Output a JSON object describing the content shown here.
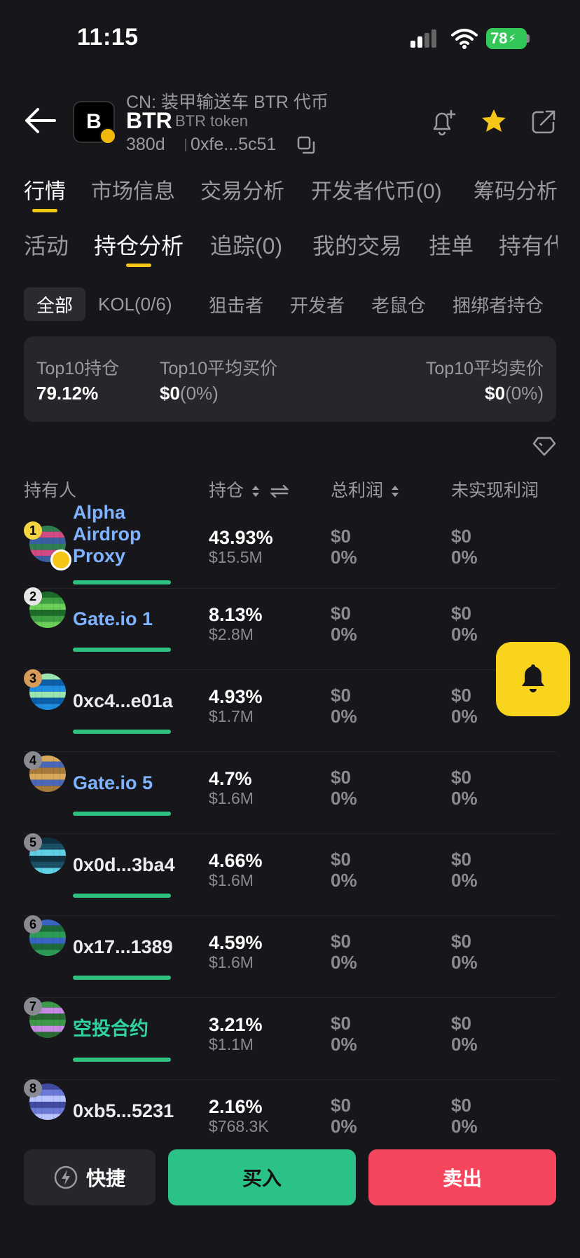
{
  "status_bar": {
    "time": "11:15",
    "battery": "78"
  },
  "token": {
    "logo_letter": "B",
    "cn_name": "CN: 装甲输送车 BTR 代币",
    "symbol": "BTR",
    "name": "BTR token",
    "age": "380d",
    "address": "0xfe...5c51"
  },
  "tabs_primary": [
    "行情",
    "市场信息",
    "交易分析",
    "开发者代币(0)",
    "筹码分析"
  ],
  "tabs_secondary": [
    "活动",
    "持仓分析",
    "追踪(0)",
    "我的交易",
    "挂单",
    "持有代"
  ],
  "filters": [
    "全部",
    "KOL(0/6)",
    "狙击者",
    "开发者",
    "老鼠仓",
    "捆绑者持仓"
  ],
  "summary": {
    "top10_hold_label": "Top10持仓",
    "top10_hold_value": "79.12%",
    "avg_buy_label": "Top10平均买价",
    "avg_buy_value": "$0",
    "avg_buy_change": "(0%)",
    "avg_sell_label": "Top10平均卖价",
    "avg_sell_value": "$0",
    "avg_sell_change": "(0%)"
  },
  "columns": {
    "holder": "持有人",
    "position": "持仓",
    "total_pnl": "总利润",
    "unrealized_pnl": "未实现利润"
  },
  "holders": [
    {
      "rank": "1",
      "name": "Alpha Airdrop Proxy",
      "name_lines": [
        "Alpha",
        "Airdrop",
        "Proxy"
      ],
      "pct": "43.93%",
      "usd": "$15.5M",
      "total_pnl": "$0",
      "total_pnl_pct": "0%",
      "unreal_pnl": "$0",
      "unreal_pnl_pct": "0%"
    },
    {
      "rank": "2",
      "name": "Gate.io 1",
      "pct": "8.13%",
      "usd": "$2.8M",
      "total_pnl": "$0",
      "total_pnl_pct": "0%",
      "unreal_pnl": "$0",
      "unreal_pnl_pct": "0%"
    },
    {
      "rank": "3",
      "name": "0xc4...e01a",
      "pct": "4.93%",
      "usd": "$1.7M",
      "total_pnl": "$0",
      "total_pnl_pct": "0%",
      "unreal_pnl": "$0",
      "unreal_pnl_pct": "0%"
    },
    {
      "rank": "4",
      "name": "Gate.io 5",
      "pct": "4.7%",
      "usd": "$1.6M",
      "total_pnl": "$0",
      "total_pnl_pct": "0%",
      "unreal_pnl": "$0",
      "unreal_pnl_pct": "0%"
    },
    {
      "rank": "5",
      "name": "0x0d...3ba4",
      "pct": "4.66%",
      "usd": "$1.6M",
      "total_pnl": "$0",
      "total_pnl_pct": "0%",
      "unreal_pnl": "$0",
      "unreal_pnl_pct": "0%"
    },
    {
      "rank": "6",
      "name": "0x17...1389",
      "pct": "4.59%",
      "usd": "$1.6M",
      "total_pnl": "$0",
      "total_pnl_pct": "0%",
      "unreal_pnl": "$0",
      "unreal_pnl_pct": "0%"
    },
    {
      "rank": "7",
      "name": "空投合约",
      "pct": "3.21%",
      "usd": "$1.1M",
      "total_pnl": "$0",
      "total_pnl_pct": "0%",
      "unreal_pnl": "$0",
      "unreal_pnl_pct": "0%"
    },
    {
      "rank": "8",
      "name": "0xb5...5231",
      "pct": "2.16%",
      "usd": "$768.3K",
      "total_pnl": "$0",
      "total_pnl_pct": "0%",
      "unreal_pnl": "$0",
      "unreal_pnl_pct": "0%"
    }
  ],
  "bottom_bar": {
    "quick": "快捷",
    "buy": "买入",
    "sell": "卖出"
  },
  "colors": {
    "accent": "#f5c518",
    "buy": "#2bc287",
    "sell": "#f6465d",
    "link": "#7fb2ff"
  }
}
